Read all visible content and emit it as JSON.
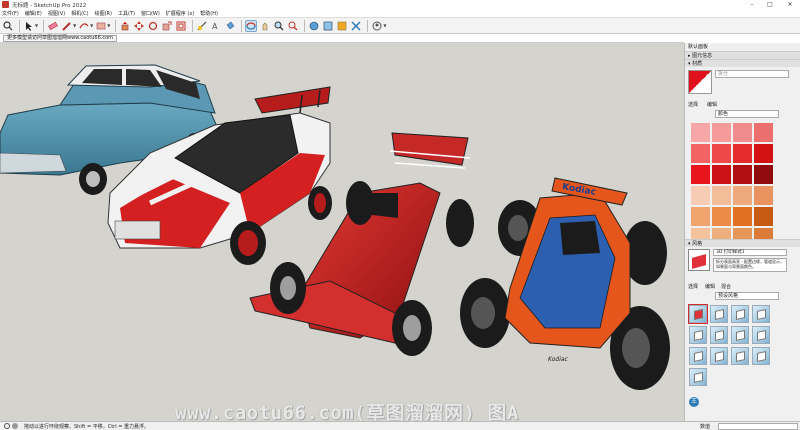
{
  "app": {
    "title": "无标题 - SketchUp Pro 2022"
  },
  "menu": [
    "文件(F)",
    "编辑(E)",
    "视图(V)",
    "相机(C)",
    "绘图(R)",
    "工具(T)",
    "窗口(W)",
    "扩展程序 (x)",
    "帮助(H)"
  ],
  "scene_tab": "更多模型请访问草图溜溜网www.caotu66.com",
  "watermark": "www.caotu66.com(草图溜溜网) 图A",
  "tray": {
    "title": "默认面板",
    "section_scene_info": "图元信息",
    "section_materials": "材质",
    "material_name_placeholder": "拆分",
    "tab_select": "选择",
    "tab_edit": "编辑",
    "material_category": "颜色",
    "section_styles": "风格",
    "style_name": "3D 打印样式1",
    "style_desc": "拆分表面高亮 - 配置边缘，管道显示，如果面与背景面颜色。",
    "tab_select2": "选择",
    "tab_edit2": "编辑",
    "tab_mix": "混合",
    "style_category": "预设风格"
  },
  "swatch_colors": [
    [
      "#f7a7a7",
      "#f59b9b",
      "#f28b8b",
      "#ec6f6f"
    ],
    [
      "#f26363",
      "#ee4848",
      "#e52b2b",
      "#d31313"
    ],
    [
      "#e8161c",
      "#cc1216",
      "#b30f12",
      "#900b0d"
    ],
    [
      "#f6cdb4",
      "#f3bd9a",
      "#eea97c",
      "#e89360"
    ],
    [
      "#f2a46f",
      "#ec8a48",
      "#e36f21",
      "#c75a12"
    ],
    [
      "#f4c39e",
      "#efae7e",
      "#e7965a",
      "#dc7b37"
    ]
  ],
  "status": {
    "text": "拖动以进行环绕观察。Shift = 平移，Ctrl = 重力悬浮。",
    "measure_label": "数值"
  },
  "toolbar_icons": [
    "select-icon",
    "eraser-icon",
    "pencil-icon",
    "shapes-icon",
    "push-pull-icon",
    "move-icon",
    "rotate-icon",
    "scale-icon",
    "offset-icon",
    "tape-icon",
    "text-icon",
    "paint-icon",
    "orbit-icon",
    "pan-icon",
    "zoom-icon",
    "zoom-extents-icon",
    "warehouse-icon",
    "extension-icon",
    "user-icon"
  ],
  "car_labels": {
    "monster_truck_banner": "Kodiac",
    "monster_truck_side": "Kodiac"
  }
}
